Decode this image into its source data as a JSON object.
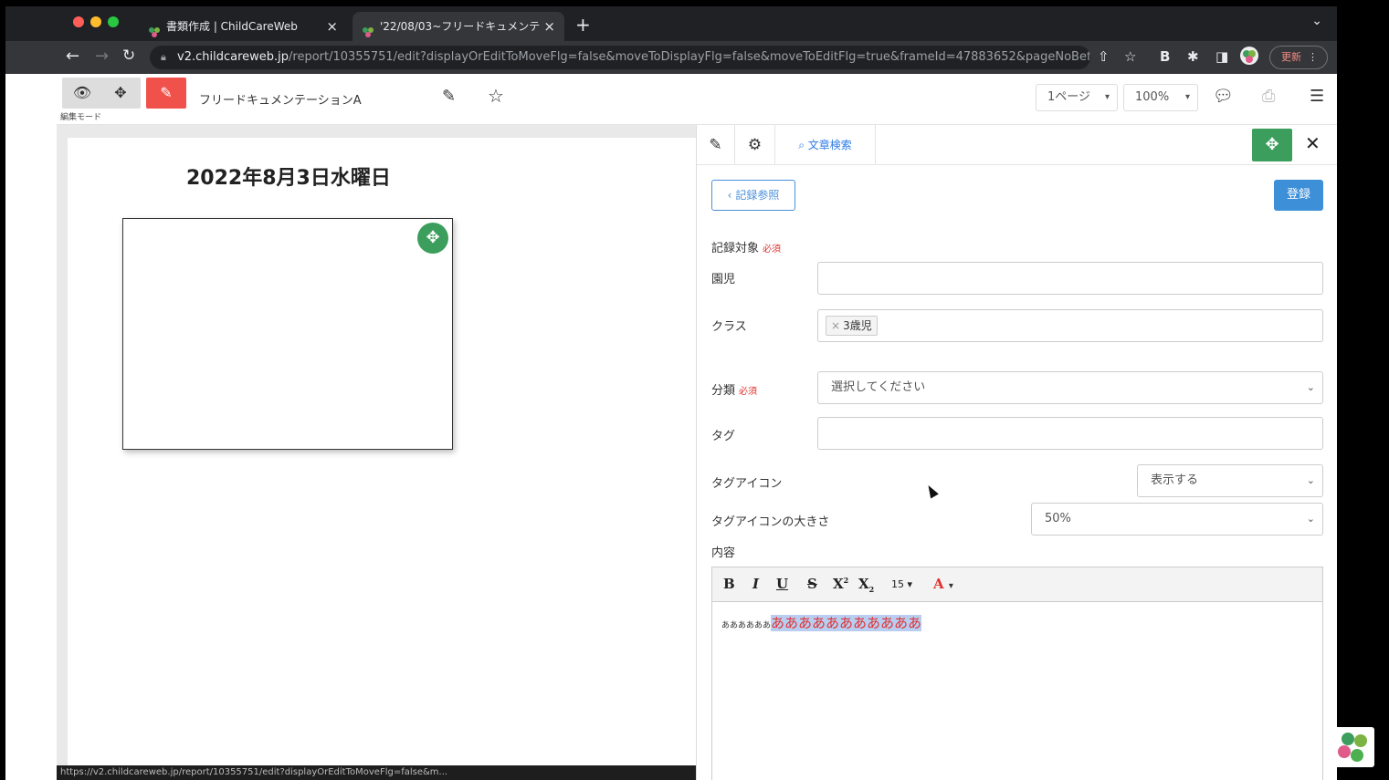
{
  "browser": {
    "tabs": [
      {
        "title": "書類作成 | ChildCareWeb"
      },
      {
        "title": "'22/08/03~フリードキュメンテ"
      }
    ],
    "url_host": "v2.childcareweb.jp",
    "url_path": "/report/10355751/edit?displayOrEditToMoveFlg=false&moveToDisplayFlg=false&moveToEditFlg=true&frameId=47883652&pageNoBef...",
    "update_label": "更新",
    "status_url": "https://v2.childcareweb.jp/report/10355751/edit?displayOrEditToMoveFlg=false&m..."
  },
  "toolbar": {
    "mode_label": "編集モード",
    "doc_title": "フリードキュメンテーションA",
    "page_select": "1ページ",
    "zoom_select": "100%"
  },
  "canvas": {
    "date_title": "2022年8月3日水曜日"
  },
  "panel": {
    "search_tab": "文章検索",
    "back_button": "記録参照",
    "register_button": "登録",
    "record_target_label": "記録対象",
    "required": "必須",
    "child_label": "園児",
    "class_label": "クラス",
    "class_chip": "3歳児",
    "category_label": "分類",
    "category_placeholder": "選択してください",
    "tag_label": "タグ",
    "tag_icon_label": "タグアイコン",
    "tag_icon_value": "表示する",
    "tag_icon_size_label": "タグアイコンの大きさ",
    "tag_icon_size_value": "50%",
    "content_label": "内容",
    "font_size": "15",
    "content_small": "ああああああ",
    "content_highlight": "あああああああああああ"
  },
  "colors": {
    "accent_blue": "#3d8fd8",
    "move_green": "#3c9e5c",
    "edit_red": "#f0524b",
    "required_red": "#e03131"
  }
}
